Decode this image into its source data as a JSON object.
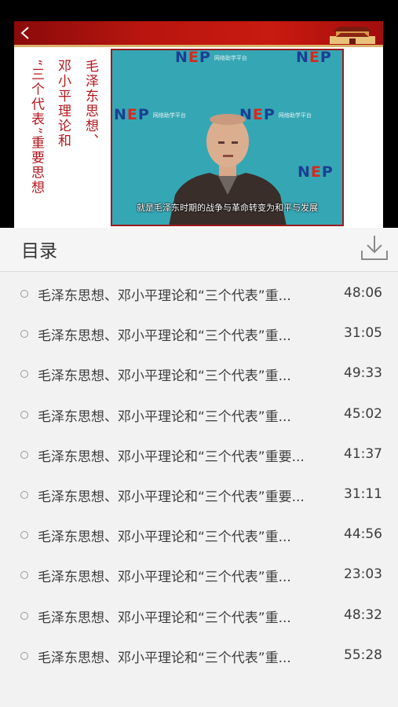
{
  "video": {
    "slide_title_lines": [
      "毛泽东思想、",
      "邓小平理论和",
      "“三个代表”重要思想"
    ],
    "watermark": {
      "logo_n": "N",
      "logo_e": "E",
      "logo_p": "P",
      "subtitle": "网络助学平台"
    },
    "caption": "就是毛泽东时期的战争与革命转变为和平与发展"
  },
  "catalog": {
    "title": "目录",
    "items": [
      {
        "title": "毛泽东思想、邓小平理论和“三个代表”重...",
        "duration": "48:06"
      },
      {
        "title": "毛泽东思想、邓小平理论和“三个代表”重...",
        "duration": "31:05"
      },
      {
        "title": "毛泽东思想、邓小平理论和“三个代表”重...",
        "duration": "49:33"
      },
      {
        "title": "毛泽东思想、邓小平理论和“三个代表”重...",
        "duration": "45:02"
      },
      {
        "title": "毛泽东思想、邓小平理论和“三个代表”重要...",
        "duration": "41:37"
      },
      {
        "title": "毛泽东思想、邓小平理论和“三个代表”重要...",
        "duration": "31:11"
      },
      {
        "title": "毛泽东思想、邓小平理论和“三个代表”重...",
        "duration": "44:56"
      },
      {
        "title": "毛泽东思想、邓小平理论和“三个代表”重...",
        "duration": "23:03"
      },
      {
        "title": "毛泽东思想、邓小平理论和“三个代表”重...",
        "duration": "48:32"
      },
      {
        "title": "毛泽东思想、邓小平理论和“三个代表”重...",
        "duration": "55:28"
      }
    ]
  },
  "icons": {
    "back": "chevron-left-icon",
    "download": "download-icon"
  },
  "colors": {
    "header_red": "#b8160f",
    "title_red": "#b3171d",
    "video_bg": "#35a7b4",
    "list_bg": "#f2f2f2"
  }
}
